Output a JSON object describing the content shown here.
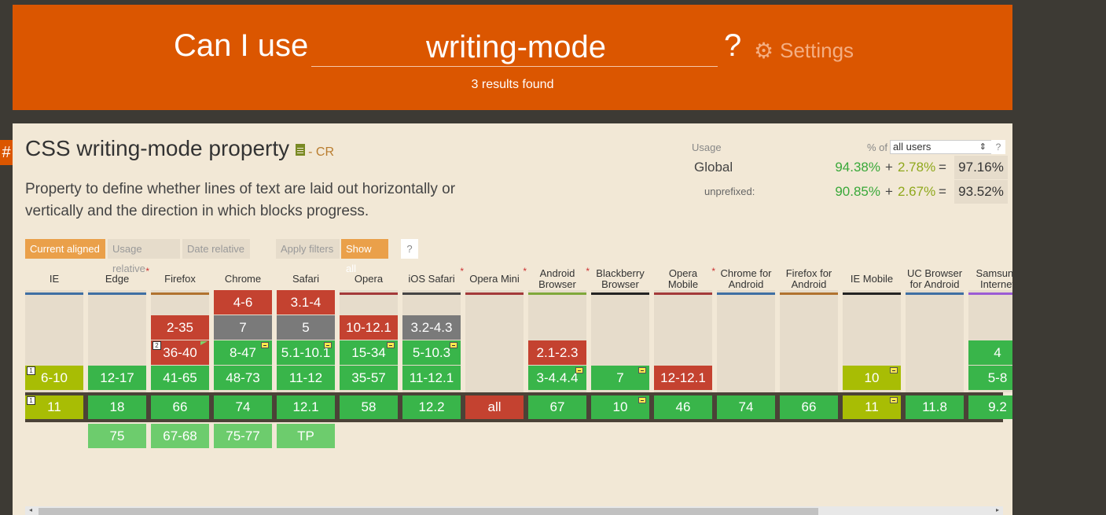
{
  "header": {
    "prefix": "Can I use",
    "query": "writing-mode",
    "question_mark": "?",
    "settings_label": "Settings",
    "results": "3 results found"
  },
  "feature": {
    "hash": "#",
    "title": "CSS writing-mode property",
    "status": "- CR",
    "description": "Property to define whether lines of text are laid out horizontally or vertically and the direction in which blocks progress."
  },
  "usage": {
    "label": "Usage",
    "pct_of": "% of",
    "users_select": "all users",
    "help": "?",
    "global_label": "Global",
    "global_full": "94.38%",
    "global_partial": "2.78%",
    "global_total": "97.16%",
    "unprefixed_label": "unprefixed:",
    "unprefixed_full": "90.85%",
    "unprefixed_partial": "2.67%",
    "unprefixed_total": "93.52%",
    "plus": "+",
    "equals": "="
  },
  "controls": {
    "current_aligned": "Current aligned",
    "usage_relative": "Usage relative",
    "date_relative": "Date relative",
    "apply_filters": "Apply filters",
    "show_all": "Show all",
    "help": "?"
  },
  "browsers": [
    {
      "name": "IE",
      "star": "",
      "color": "#3f6fa3"
    },
    {
      "name": "Edge",
      "star": "*",
      "color": "#3f6fa3"
    },
    {
      "name": "Firefox",
      "star": "",
      "color": "#b0722f"
    },
    {
      "name": "Chrome",
      "star": "",
      "color": "#3f6fa3"
    },
    {
      "name": "Safari",
      "star": "",
      "color": "#3f6fa3"
    },
    {
      "name": "Opera",
      "star": "",
      "color": "#a33939"
    },
    {
      "name": "iOS Safari",
      "star": "*",
      "color": "#444444"
    },
    {
      "name": "Opera Mini",
      "star": "*",
      "color": "#a33939"
    },
    {
      "name": "Android Browser",
      "star": "*",
      "color": "#7fa83a"
    },
    {
      "name": "Blackberry Browser",
      "star": "",
      "color": "#222222"
    },
    {
      "name": "Opera Mobile",
      "star": "*",
      "color": "#a33939"
    },
    {
      "name": "Chrome for Android",
      "star": "",
      "color": "#3f6fa3"
    },
    {
      "name": "Firefox for Android",
      "star": "",
      "color": "#b0722f"
    },
    {
      "name": "IE Mobile",
      "star": "",
      "color": "#222222"
    },
    {
      "name": "UC Browser for Android",
      "star": "",
      "color": "#3f6fa3"
    },
    {
      "name": "Samsung Internet",
      "star": "",
      "color": "#9b5bd4"
    }
  ],
  "cells": [
    {
      "col": 0,
      "row": 3,
      "text": "6-10",
      "type": "olive",
      "note": "1"
    },
    {
      "col": 0,
      "row": 4,
      "text": "11",
      "type": "olive",
      "note": "1"
    },
    {
      "col": 1,
      "row": 3,
      "text": "12-17",
      "type": "green"
    },
    {
      "col": 1,
      "row": 4,
      "text": "18",
      "type": "green"
    },
    {
      "col": 1,
      "row": 5,
      "text": "75",
      "type": "lgreen"
    },
    {
      "col": 2,
      "row": 1,
      "text": "2-35",
      "type": "red"
    },
    {
      "col": 2,
      "row": 2,
      "text": "36-40",
      "type": "red",
      "note": "2",
      "greenflag": true
    },
    {
      "col": 2,
      "row": 3,
      "text": "41-65",
      "type": "green"
    },
    {
      "col": 2,
      "row": 4,
      "text": "66",
      "type": "green"
    },
    {
      "col": 2,
      "row": 5,
      "text": "67-68",
      "type": "lgreen"
    },
    {
      "col": 3,
      "row": 0,
      "text": "4-6",
      "type": "red"
    },
    {
      "col": 3,
      "row": 1,
      "text": "7",
      "type": "gray"
    },
    {
      "col": 3,
      "row": 2,
      "text": "8-47",
      "type": "green",
      "flag": true
    },
    {
      "col": 3,
      "row": 3,
      "text": "48-73",
      "type": "green"
    },
    {
      "col": 3,
      "row": 4,
      "text": "74",
      "type": "green"
    },
    {
      "col": 3,
      "row": 5,
      "text": "75-77",
      "type": "lgreen"
    },
    {
      "col": 4,
      "row": 0,
      "text": "3.1-4",
      "type": "red"
    },
    {
      "col": 4,
      "row": 1,
      "text": "5",
      "type": "gray"
    },
    {
      "col": 4,
      "row": 2,
      "text": "5.1-10.1",
      "type": "green",
      "flag": true
    },
    {
      "col": 4,
      "row": 3,
      "text": "11-12",
      "type": "green"
    },
    {
      "col": 4,
      "row": 4,
      "text": "12.1",
      "type": "green"
    },
    {
      "col": 4,
      "row": 5,
      "text": "TP",
      "type": "lgreen"
    },
    {
      "col": 5,
      "row": 1,
      "text": "10-12.1",
      "type": "red"
    },
    {
      "col": 5,
      "row": 2,
      "text": "15-34",
      "type": "green",
      "flag": true
    },
    {
      "col": 5,
      "row": 3,
      "text": "35-57",
      "type": "green"
    },
    {
      "col": 5,
      "row": 4,
      "text": "58",
      "type": "green"
    },
    {
      "col": 6,
      "row": 1,
      "text": "3.2-4.3",
      "type": "gray"
    },
    {
      "col": 6,
      "row": 2,
      "text": "5-10.3",
      "type": "green",
      "flag": true
    },
    {
      "col": 6,
      "row": 3,
      "text": "11-12.1",
      "type": "green"
    },
    {
      "col": 6,
      "row": 4,
      "text": "12.2",
      "type": "green"
    },
    {
      "col": 7,
      "row": 4,
      "text": "all",
      "type": "red"
    },
    {
      "col": 8,
      "row": 2,
      "text": "2.1-2.3",
      "type": "red"
    },
    {
      "col": 8,
      "row": 3,
      "text": "3-4.4.4",
      "type": "green",
      "flag": true
    },
    {
      "col": 8,
      "row": 4,
      "text": "67",
      "type": "green"
    },
    {
      "col": 9,
      "row": 3,
      "text": "7",
      "type": "green",
      "flag": true
    },
    {
      "col": 9,
      "row": 4,
      "text": "10",
      "type": "green",
      "flag": true
    },
    {
      "col": 10,
      "row": 3,
      "text": "12-12.1",
      "type": "red"
    },
    {
      "col": 10,
      "row": 4,
      "text": "46",
      "type": "green"
    },
    {
      "col": 11,
      "row": 4,
      "text": "74",
      "type": "green"
    },
    {
      "col": 12,
      "row": 4,
      "text": "66",
      "type": "green"
    },
    {
      "col": 13,
      "row": 3,
      "text": "10",
      "type": "olive",
      "flag": true
    },
    {
      "col": 13,
      "row": 4,
      "text": "11",
      "type": "olive",
      "flag": true
    },
    {
      "col": 14,
      "row": 4,
      "text": "11.8",
      "type": "green"
    },
    {
      "col": 15,
      "row": 2,
      "text": "4",
      "type": "green"
    },
    {
      "col": 15,
      "row": 3,
      "text": "5-8",
      "type": "green"
    },
    {
      "col": 15,
      "row": 4,
      "text": "9.2",
      "type": "green"
    }
  ],
  "scrollbar": {
    "left": "◂",
    "right": "▸"
  }
}
